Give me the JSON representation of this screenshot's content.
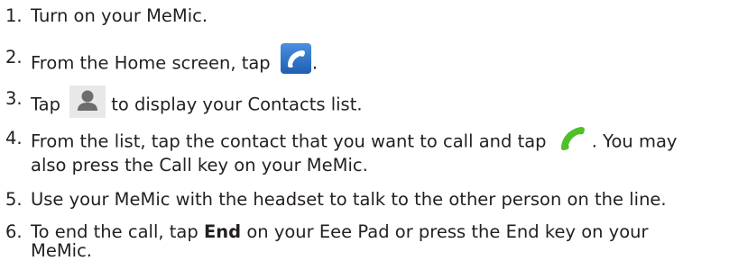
{
  "steps": [
    {
      "number": "1.",
      "text": "Turn on your MeMic."
    },
    {
      "number": "2.",
      "text_before": "From the Home screen, tap",
      "icon": "phone-app-icon",
      "text_after": "."
    },
    {
      "number": "3.",
      "text_before": "Tap",
      "icon": "contacts-person-icon",
      "text_after": "to display your Contacts list."
    },
    {
      "number": "4.",
      "text_before": "From the list, tap the contact that you want to call and tap",
      "icon": "green-call-handset-icon",
      "text_after": ". You may",
      "line2": "also press the Call key on your MeMic."
    },
    {
      "number": "5.",
      "text": "Use your MeMic with the headset to talk to the other person on the line."
    },
    {
      "number": "6.",
      "text_before": "To end the call, tap",
      "bold": "End",
      "text_after": "on your Eee Pad or press the End key on your",
      "line2": "MeMic."
    }
  ],
  "colors": {
    "text": "#231f20",
    "phone_icon_bg": "#2f74c9",
    "call_green": "#4fbf2a",
    "contacts_icon_bg": "#e8e8e8",
    "contacts_person": "#6d6d6d"
  }
}
